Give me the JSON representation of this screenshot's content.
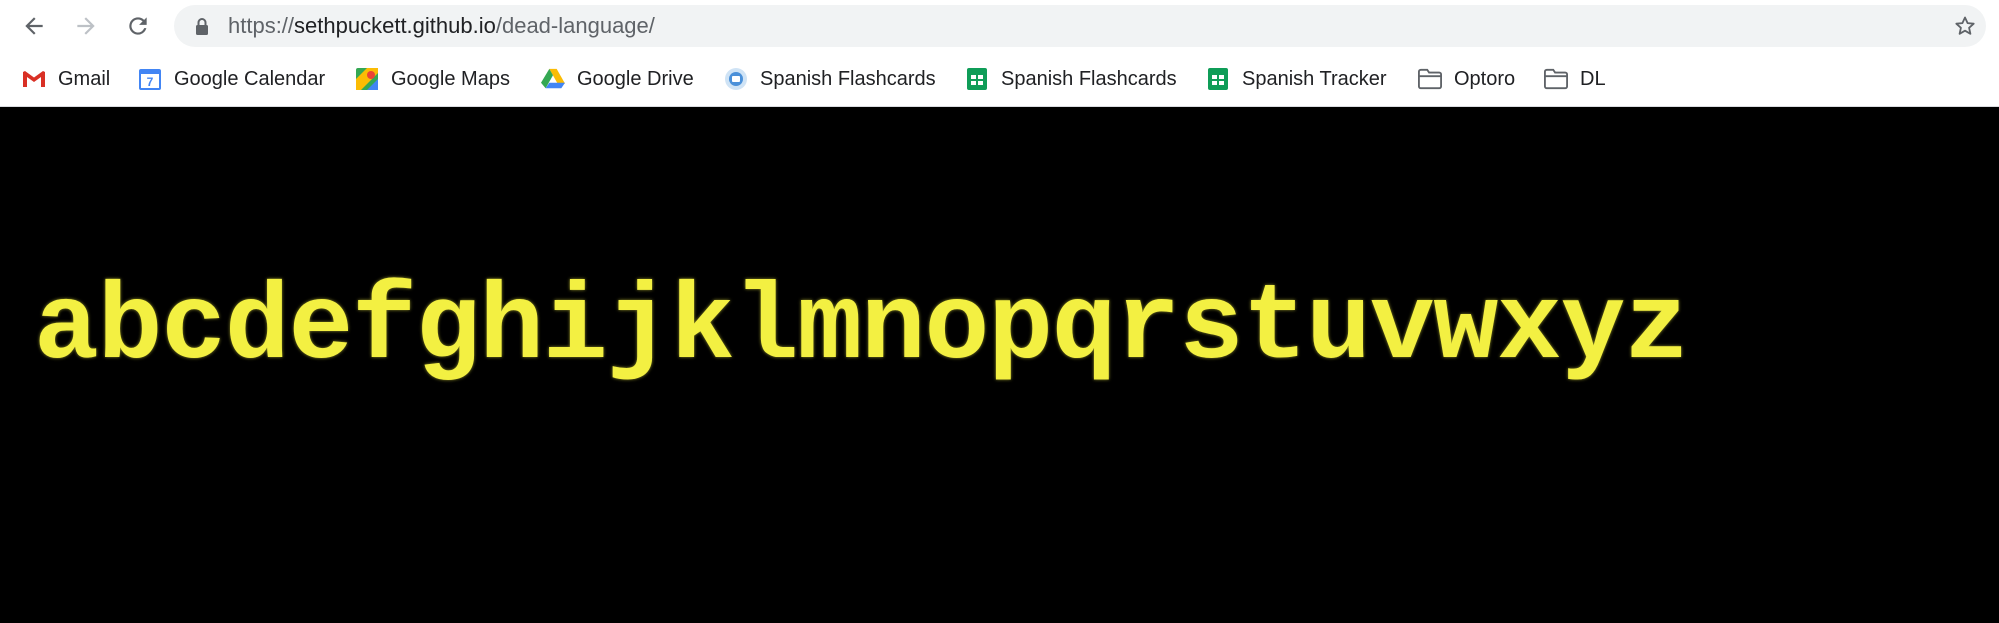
{
  "browser": {
    "url_scheme": "https://",
    "url_host": "sethpuckett.github.io",
    "url_path": "/dead-language/",
    "back_icon": "arrow-left-icon",
    "forward_icon": "arrow-right-icon",
    "reload_icon": "reload-icon",
    "lock_icon": "lock-icon",
    "star_icon": "star-icon"
  },
  "bookmarks": [
    {
      "label": "Gmail",
      "icon": "gmail-icon"
    },
    {
      "label": "Google Calendar",
      "icon": "google-calendar-icon"
    },
    {
      "label": "Google Maps",
      "icon": "google-maps-icon"
    },
    {
      "label": "Google Drive",
      "icon": "google-drive-icon"
    },
    {
      "label": "Spanish Flashcards",
      "icon": "flashcards-app-icon"
    },
    {
      "label": "Spanish Flashcards",
      "icon": "google-sheets-icon"
    },
    {
      "label": "Spanish Tracker",
      "icon": "google-sheets-icon"
    },
    {
      "label": "Optoro",
      "icon": "folder-icon"
    },
    {
      "label": "DL",
      "icon": "folder-icon"
    }
  ],
  "page": {
    "text": "abcdefghijklmnopqrstuvwxyz",
    "text_color": "#f3f042",
    "background": "#000000"
  },
  "calendar_day": "7"
}
